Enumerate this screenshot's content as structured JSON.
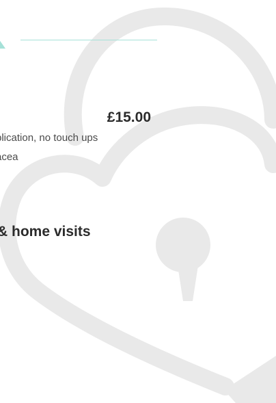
{
  "service": {
    "price": "£15.00",
    "desc_line1": "plication, no touch ups",
    "desc_line2": "acea"
  },
  "section": {
    "title": "& home visits"
  },
  "theme": {
    "accent": "#a6e1d8",
    "watermark": "#e9e9e9",
    "text": "#333333"
  },
  "icons": {
    "background": "heart-lock-icon",
    "accent": "triangle-accent-icon"
  }
}
